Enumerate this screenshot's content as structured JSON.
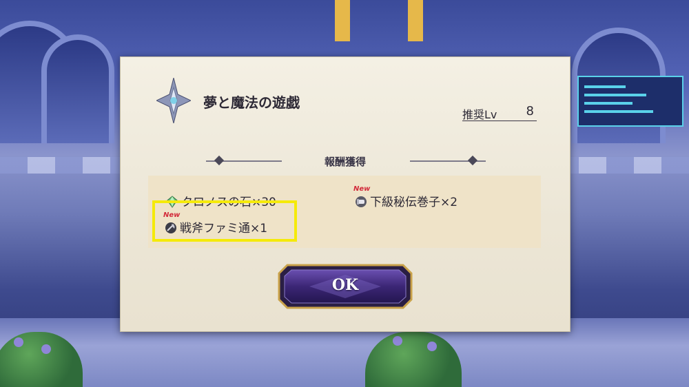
{
  "dialog": {
    "title": "夢と魔法の遊戯",
    "recommended_level": {
      "label": "推奨Lv",
      "value": "8"
    },
    "reward_header": "報酬獲得",
    "rewards": [
      {
        "name": "クロノスの石×30",
        "icon": "gem-icon",
        "new": false
      },
      {
        "name": "下級秘伝巻子×2",
        "icon": "scroll-icon",
        "new": true,
        "new_label": "New"
      },
      {
        "name": "戦斧ファミ通×1",
        "icon": "axe-icon",
        "new": true,
        "new_label": "New",
        "highlighted": true
      }
    ],
    "ok_label": "OK"
  },
  "colors": {
    "highlight": "#f5ea0a",
    "new_tag": "#d22a3a",
    "button": "#4a2f8a"
  }
}
